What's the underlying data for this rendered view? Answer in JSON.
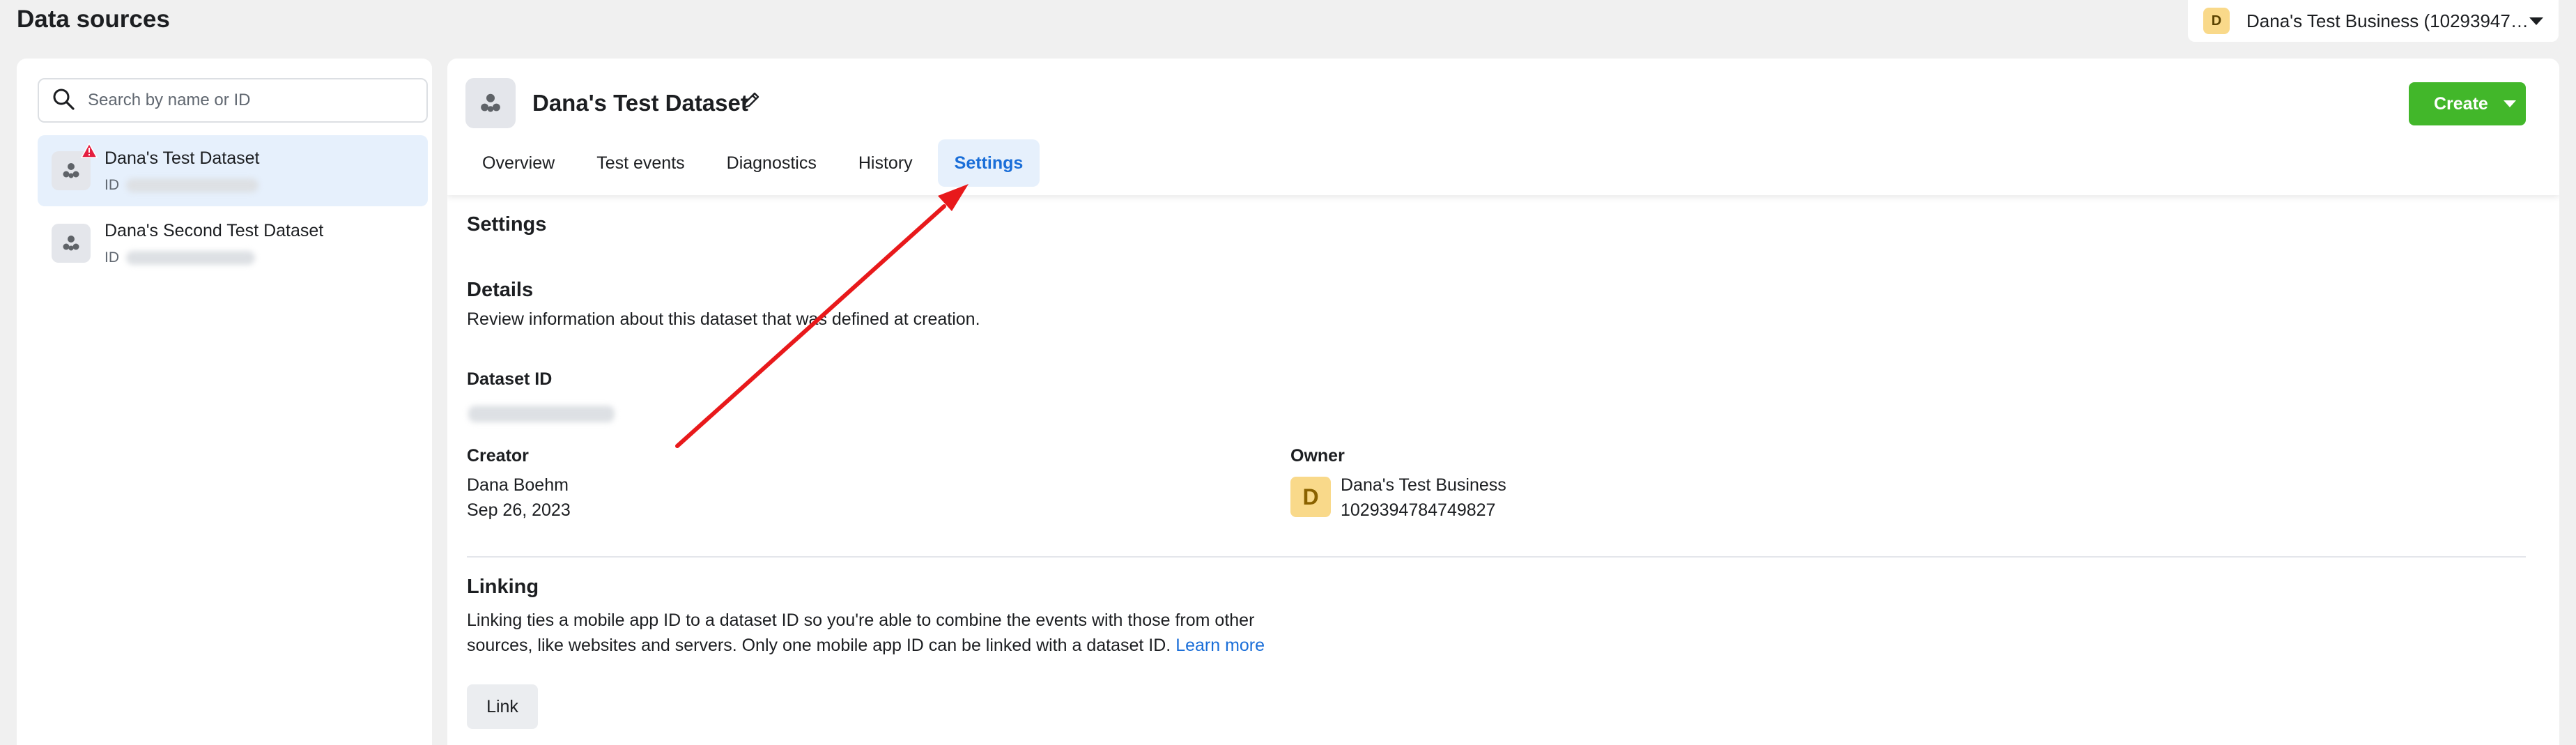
{
  "page": {
    "title": "Data sources"
  },
  "business_selector": {
    "avatar_letter": "D",
    "name": "Dana's Test Business (10293947…"
  },
  "sidebar": {
    "search_placeholder": "Search by name or ID",
    "items": [
      {
        "name": "Dana's Test Dataset",
        "id_label": "ID",
        "selected": true,
        "has_warning": true
      },
      {
        "name": "Dana's Second Test Dataset",
        "id_label": "ID",
        "selected": false,
        "has_warning": false
      }
    ]
  },
  "main": {
    "dataset_title": "Dana's Test Dataset",
    "create_label": "Create",
    "tabs": [
      {
        "label": "Overview"
      },
      {
        "label": "Test events"
      },
      {
        "label": "Diagnostics"
      },
      {
        "label": "History"
      },
      {
        "label": "Settings",
        "active": true
      }
    ],
    "settings": {
      "heading": "Settings",
      "details": {
        "title": "Details",
        "description": "Review information about this dataset that was defined at creation.",
        "dataset_id_label": "Dataset ID",
        "creator_label": "Creator",
        "creator_name": "Dana Boehm",
        "creator_date": "Sep 26, 2023",
        "owner_label": "Owner",
        "owner_avatar_letter": "D",
        "owner_name": "Dana's Test Business",
        "owner_id": "1029394784749827"
      },
      "linking": {
        "title": "Linking",
        "description_line1": "Linking ties a mobile app ID to a dataset ID so you're able to combine the events with those from other",
        "description_line2": "sources, like websites and servers. Only one mobile app ID can be linked with a dataset ID.",
        "learn_more": "Learn more",
        "link_button": "Link"
      }
    }
  },
  "colors": {
    "primary_blue": "#1a6ed8",
    "create_green": "#42b72a",
    "selected_bg": "#e6f0fc",
    "annotation_arrow": "#e8191b",
    "warning_red": "#e41e3f",
    "avatar_yellow": "#f9d98a"
  },
  "icons": {
    "search": "search-icon",
    "dataset": "dataset-icon",
    "warning": "warning-icon",
    "edit": "pencil-icon",
    "dropdown": "chevron-down-icon"
  }
}
